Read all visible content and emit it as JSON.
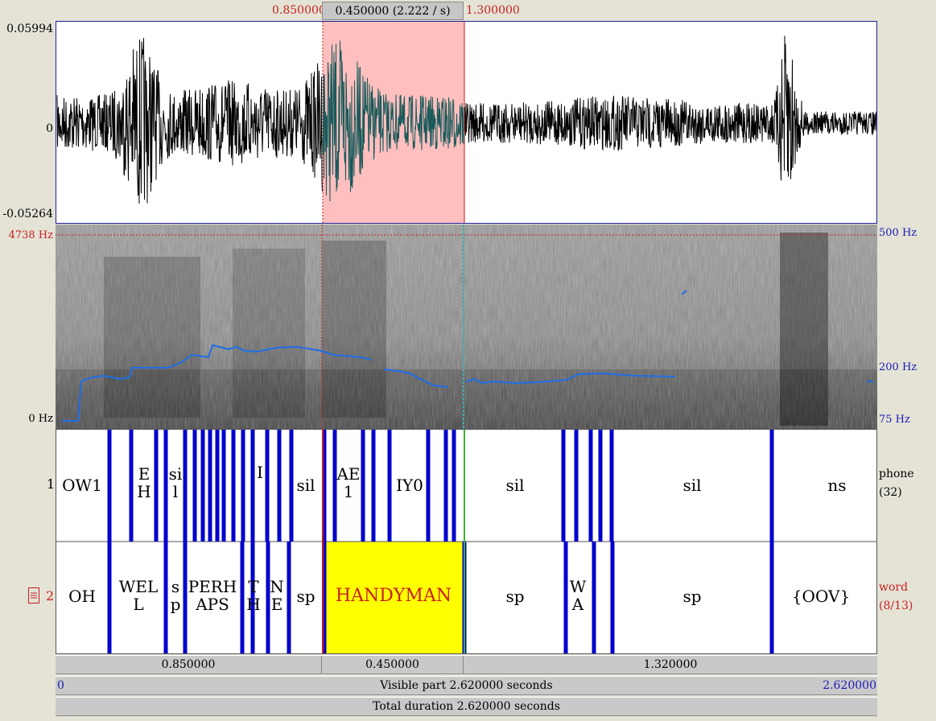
{
  "selection": {
    "start": "0.850000",
    "length_label": "0.450000 (2.222 / s)",
    "end": "1.300000"
  },
  "waveform": {
    "max": "0.05994",
    "zero": "0",
    "min": "-0.05264"
  },
  "spectrogram": {
    "freq_top": "4738 Hz",
    "freq_bottom": "0 Hz",
    "pitch_top": "500 Hz",
    "pitch_mid": "200 Hz",
    "pitch_bottom": "75 Hz"
  },
  "tier1": {
    "number": "1",
    "name": "phone",
    "count": "(32)",
    "labels": [
      "OW1",
      "E\nH",
      "si\nl",
      "I",
      "sil",
      "AE\n1",
      "IY0",
      "sil",
      "sil",
      "ns"
    ]
  },
  "tier2": {
    "number": "2",
    "name": "word",
    "count": "(8/13)",
    "labels": [
      "OH",
      "WEL\nL",
      "s\np",
      "PERH\nAPS",
      "T\nH",
      "N\nE",
      "sp",
      "HANDYMAN",
      "sp",
      "W\nA",
      "sp",
      "{OOV}"
    ]
  },
  "segment_bar": {
    "left": "0.850000",
    "middle": "0.450000",
    "right": "1.320000"
  },
  "visible_bar": {
    "start": "0",
    "label": "Visible part 2.620000 seconds",
    "end": "2.620000"
  },
  "total_bar": {
    "label": "Total duration 2.620000 seconds"
  },
  "colors": {
    "selection": "#ffbfbf",
    "highlight": "#ffff00",
    "pitch": "#1e6ee6",
    "boundary": "#0000cc"
  },
  "icons": [
    "lock-icon"
  ]
}
